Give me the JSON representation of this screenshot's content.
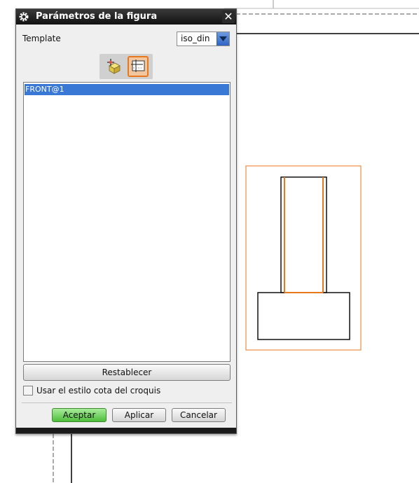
{
  "dialog": {
    "title": "Parámetros de la figura",
    "close_symbol": "✕",
    "template_label": "Template",
    "template_value": "iso_din",
    "tools": [
      {
        "name": "add-view-icon"
      },
      {
        "name": "sketch-view-icon",
        "active": true
      }
    ],
    "views": [
      "FRONT@1"
    ],
    "reset_label": "Restablecer",
    "sketch_style_label": "Usar el estilo cota del croquis",
    "sketch_style_checked": false,
    "ok_label": "Aceptar",
    "apply_label": "Aplicar",
    "cancel_label": "Cancelar"
  },
  "colors": {
    "highlight": "#e8781e",
    "selection": "#3a78d6",
    "ok_green": "#4fbe3b"
  }
}
